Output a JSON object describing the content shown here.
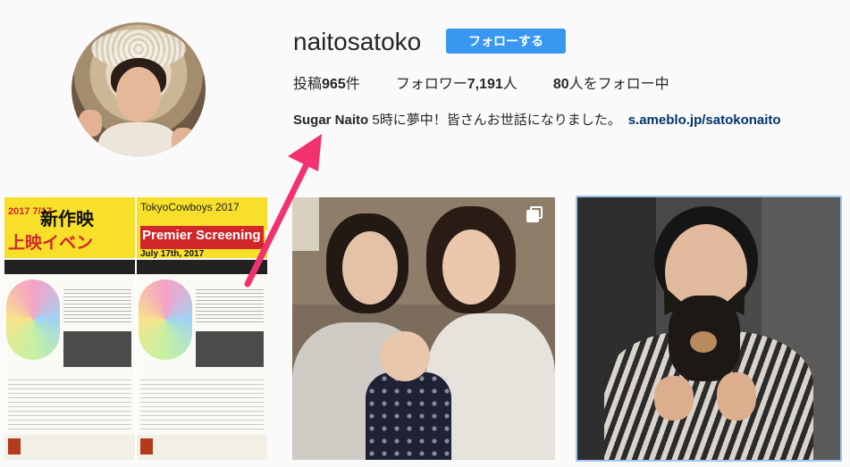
{
  "profile": {
    "username": "naitosatoko",
    "follow_label": "フォローする",
    "stats": {
      "posts_prefix": "投稿",
      "posts_count": "965",
      "posts_suffix": "件",
      "followers_prefix": "フォロワー",
      "followers_count": "7,191",
      "followers_suffix": "人",
      "following_count": "80",
      "following_suffix": "人をフォロー中"
    },
    "bio": {
      "name": "Sugar Naito",
      "text": " 5時に夢中！皆さんお世話になりました。",
      "link": "s.ameblo.jp/satokonaito"
    }
  },
  "posts": [
    {
      "flyer_a": {
        "date": "2017 7/17",
        "headline": "新作映",
        "red_text": "上映イベン"
      },
      "flyer_b": {
        "title": "TokyoCowboys 2017",
        "red_text": "Premier Screening Ev",
        "date": "July 17th, 2017"
      }
    },
    {
      "multi_image": true
    },
    {
      "selected": true
    }
  ],
  "colors": {
    "follow_button": "#3897f0",
    "link": "#003569",
    "arrow": "#f2326f",
    "selected_outline": "#9fc5ea"
  },
  "icons": {
    "multi_image": "carousel-icon"
  }
}
